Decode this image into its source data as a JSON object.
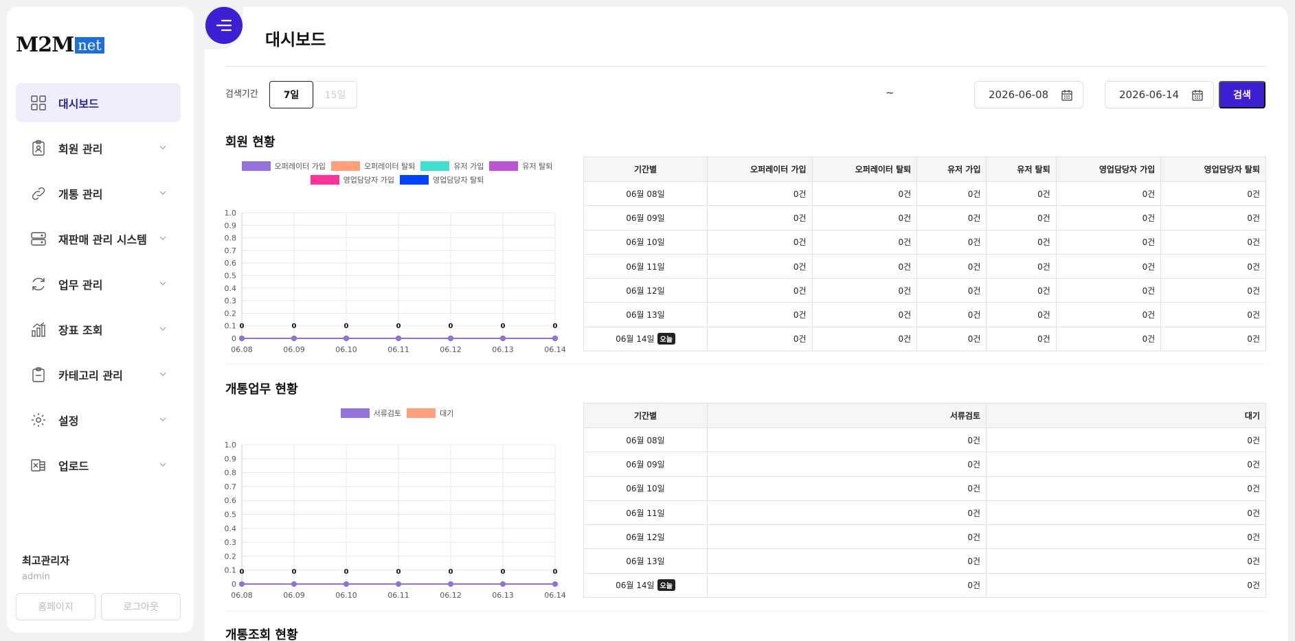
{
  "sidebar": {
    "logo_m2m": "M2M",
    "logo_net": "net",
    "items": [
      {
        "label": "대시보드",
        "icon": "grid-icon"
      },
      {
        "label": "회원 관리",
        "icon": "id-badge-icon"
      },
      {
        "label": "개통 관리",
        "icon": "link-icon"
      },
      {
        "label": "재판매 관리 시스템",
        "icon": "server-icon"
      },
      {
        "label": "업무 관리",
        "icon": "refresh-icon"
      },
      {
        "label": "장표 조회",
        "icon": "bar-chart-icon"
      },
      {
        "label": "카테고리 관리",
        "icon": "clipboard-icon"
      },
      {
        "label": "설정",
        "icon": "gear-icon"
      },
      {
        "label": "업로드",
        "icon": "excel-icon"
      }
    ],
    "user_name": "최고관리자",
    "user_id": "admin",
    "homepage_button": "홈페이지",
    "logout_button": "로그아웃"
  },
  "header": {
    "title": "대시보드"
  },
  "filter": {
    "label": "검색기간",
    "period_7": "7일",
    "period_15": "15일",
    "start_date": "2026-06-08",
    "separator": "~",
    "end_date": "2026-06-14",
    "search_button": "검색"
  },
  "colors": {
    "accent": "#3e1fd4",
    "series_operator_join": "#9370db",
    "series_operator_leave": "#ffa07a",
    "series_user_join": "#40e0d0",
    "series_user_leave": "#ba55d3",
    "series_sales_join": "#ff3399",
    "series_sales_leave": "#0044ff"
  },
  "members": {
    "title": "회원 현황",
    "legend": [
      "오퍼레이터 가입",
      "오퍼레이터 탈퇴",
      "유저 가입",
      "유저 탈퇴",
      "영업담당자 가입",
      "영업담당자 탈퇴"
    ],
    "table": {
      "headers": [
        "기간별",
        "오퍼레이터 가입",
        "오퍼레이터 탈퇴",
        "유저 가입",
        "유저 탈퇴",
        "영업담당자 가입",
        "영업담당자 탈퇴"
      ],
      "rows": [
        {
          "date": "06월 08일",
          "values": [
            "0건",
            "0건",
            "0건",
            "0건",
            "0건",
            "0건"
          ]
        },
        {
          "date": "06월 09일",
          "values": [
            "0건",
            "0건",
            "0건",
            "0건",
            "0건",
            "0건"
          ]
        },
        {
          "date": "06월 10일",
          "values": [
            "0건",
            "0건",
            "0건",
            "0건",
            "0건",
            "0건"
          ]
        },
        {
          "date": "06월 11일",
          "values": [
            "0건",
            "0건",
            "0건",
            "0건",
            "0건",
            "0건"
          ]
        },
        {
          "date": "06월 12일",
          "values": [
            "0건",
            "0건",
            "0건",
            "0건",
            "0건",
            "0건"
          ]
        },
        {
          "date": "06월 13일",
          "values": [
            "0건",
            "0건",
            "0건",
            "0건",
            "0건",
            "0건"
          ]
        },
        {
          "date": "06월 14일",
          "badge": "오늘",
          "values": [
            "0건",
            "0건",
            "0건",
            "0건",
            "0건",
            "0건"
          ]
        }
      ]
    }
  },
  "activation": {
    "title": "개통업무 현황",
    "legend": [
      "서류검토",
      "대기"
    ],
    "table": {
      "headers": [
        "기간별",
        "서류검토",
        "대기"
      ],
      "rows": [
        {
          "date": "06월 08일",
          "values": [
            "0건",
            "0건"
          ]
        },
        {
          "date": "06월 09일",
          "values": [
            "0건",
            "0건"
          ]
        },
        {
          "date": "06월 10일",
          "values": [
            "0건",
            "0건"
          ]
        },
        {
          "date": "06월 11일",
          "values": [
            "0건",
            "0건"
          ]
        },
        {
          "date": "06월 12일",
          "values": [
            "0건",
            "0건"
          ]
        },
        {
          "date": "06월 13일",
          "values": [
            "0건",
            "0건"
          ]
        },
        {
          "date": "06월 14일",
          "badge": "오늘",
          "values": [
            "0건",
            "0건"
          ]
        }
      ]
    }
  },
  "lookup": {
    "title": "개통조회 현황"
  },
  "chart_data": [
    {
      "type": "line",
      "x": [
        "06.08",
        "06.09",
        "06.10",
        "06.11",
        "06.12",
        "06.13",
        "06.14"
      ],
      "ylim": [
        0,
        1.0
      ],
      "yticks": [
        "1.0",
        "0.9",
        "0.8",
        "0.7",
        "0.6",
        "0.5",
        "0.4",
        "0.3",
        "0.2",
        "0.1",
        "0"
      ],
      "data_labels": [
        "0",
        "0",
        "0",
        "0",
        "0",
        "0",
        "0"
      ],
      "series": [
        {
          "name": "오퍼레이터 가입",
          "values": [
            0,
            0,
            0,
            0,
            0,
            0,
            0
          ]
        },
        {
          "name": "오퍼레이터 탈퇴",
          "values": [
            0,
            0,
            0,
            0,
            0,
            0,
            0
          ]
        },
        {
          "name": "유저 가입",
          "values": [
            0,
            0,
            0,
            0,
            0,
            0,
            0
          ]
        },
        {
          "name": "유저 탈퇴",
          "values": [
            0,
            0,
            0,
            0,
            0,
            0,
            0
          ]
        },
        {
          "name": "영업담당자 가입",
          "values": [
            0,
            0,
            0,
            0,
            0,
            0,
            0
          ]
        },
        {
          "name": "영업담당자 탈퇴",
          "values": [
            0,
            0,
            0,
            0,
            0,
            0,
            0
          ]
        }
      ],
      "grid": true,
      "legend": "top"
    },
    {
      "type": "line",
      "x": [
        "06.08",
        "06.09",
        "06.10",
        "06.11",
        "06.12",
        "06.13",
        "06.14"
      ],
      "ylim": [
        0,
        1.0
      ],
      "yticks": [
        "1.0",
        "0.9",
        "0.8",
        "0.7",
        "0.6",
        "0.5",
        "0.4",
        "0.3",
        "0.2",
        "0.1",
        "0"
      ],
      "data_labels": [
        "0",
        "0",
        "0",
        "0",
        "0",
        "0",
        "0"
      ],
      "series": [
        {
          "name": "서류검토",
          "values": [
            0,
            0,
            0,
            0,
            0,
            0,
            0
          ]
        },
        {
          "name": "대기",
          "values": [
            0,
            0,
            0,
            0,
            0,
            0,
            0
          ]
        }
      ],
      "grid": true,
      "legend": "top"
    }
  ]
}
